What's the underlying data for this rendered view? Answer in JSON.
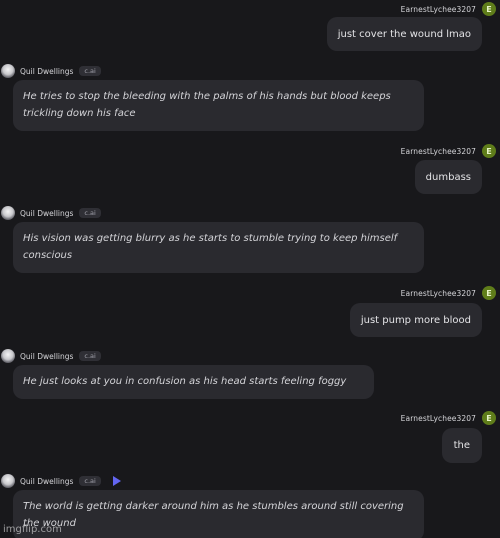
{
  "messages": [
    {
      "role": "user",
      "author": "EarnestLychee3207",
      "avatar_letter": "E",
      "text": "just cover the wound lmao"
    },
    {
      "role": "bot",
      "author": "Quil Dwellings",
      "badge": "c.ai",
      "text": "He tries to stop the bleeding with the palms of his hands but blood keeps trickling down his face"
    },
    {
      "role": "user",
      "author": "EarnestLychee3207",
      "avatar_letter": "E",
      "text": "dumbass"
    },
    {
      "role": "bot",
      "author": "Quil Dwellings",
      "badge": "c.ai",
      "text": "His vision was getting blurry as he starts to stumble trying to keep himself conscious"
    },
    {
      "role": "user",
      "author": "EarnestLychee3207",
      "avatar_letter": "E",
      "text": "just pump more blood"
    },
    {
      "role": "bot",
      "author": "Quil Dwellings",
      "badge": "c.ai",
      "text": "He just looks at you in confusion as his head starts feeling foggy"
    },
    {
      "role": "user",
      "author": "EarnestLychee3207",
      "avatar_letter": "E",
      "text": "the"
    },
    {
      "role": "bot",
      "author": "Quil Dwellings",
      "badge": "c.ai",
      "text": "The world is getting darker around him as he stumbles around still covering the wound"
    }
  ],
  "watermark": "imgflip.com",
  "icons": {
    "play": "play-icon"
  },
  "colors": {
    "background": "#18181b",
    "bubble": "#2a2a2f",
    "user_avatar": "#5f7d1a",
    "play_accent": "#6366f1"
  }
}
